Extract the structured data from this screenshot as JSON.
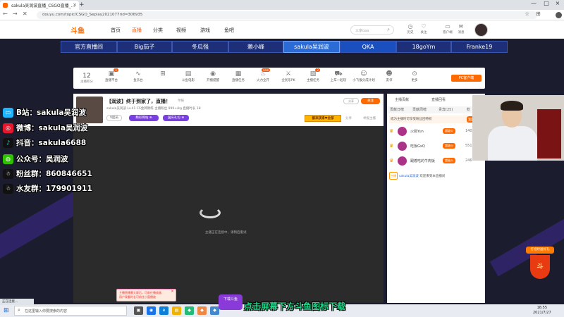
{
  "browser": {
    "tab_title": "sakula吴润波直播_CSGO直播_...",
    "url": "douyu.com/topic/CSGO_Seplay2021077rid=306935"
  },
  "site_nav": {
    "logo": "斗鱼",
    "items": [
      "首页",
      "直播",
      "分类",
      "视频",
      "游戏",
      "鱼吧"
    ],
    "active": "直播",
    "search_placeholder": "三家oaa"
  },
  "header_icons": [
    "历史",
    "关注",
    "客户端",
    "消息"
  ],
  "friend_bar": [
    "官方直播间",
    "Big茄子",
    "冬瓜强",
    "赖小峰",
    "sakula吴润波",
    "QKA",
    "18goYm",
    "Franke19"
  ],
  "friend_bar_active": "sakula吴润波",
  "social": [
    {
      "icon": "bilibili-icon",
      "text": "B站：sakula吴润波",
      "color": "#1fb6ff"
    },
    {
      "icon": "weibo-icon",
      "text": "微博：sakula吴润波",
      "color": "#e6162d"
    },
    {
      "icon": "douyin-icon",
      "text": "抖音：sakula6688",
      "color": "#111"
    },
    {
      "icon": "wechat-icon",
      "text": "公众号：吴润波",
      "color": "#2dc100"
    },
    {
      "icon": "qq-icon",
      "text": "粉丝群：860846651",
      "color": "#111"
    },
    {
      "icon": "qq-icon",
      "text": "水友群：179901911",
      "color": "#111"
    }
  ],
  "toolbar": {
    "level": "12",
    "level_label": "主播积分",
    "items": [
      "直播平台",
      "鱼乐台",
      "",
      "斗鱼电影",
      "开播提醒",
      "直播任务",
      "火力全开",
      "全民乐PK",
      "主播任务",
      "上车一起玩",
      "小飞猴分成计划",
      "友邻",
      "更多"
    ],
    "pc_button": "PC客户端"
  },
  "video": {
    "title": "【润波】终于到家了，直播！",
    "category": "举报",
    "meta": "sakula吴润波  Lv.41  CS金牌教练  主播粉丝  999+/kg  直播时长 18",
    "tag1": "V团员",
    "tag2": "精彩网站 ⊕",
    "tag3": "国庆礼包 ⊕",
    "share": "分享",
    "follow": "关注",
    "record_btn": "都来获得♥全部",
    "share2": "分享",
    "report": "举报主播",
    "loading": "主播正在连接中，请稍后重试",
    "popup_line1": "主播直播需大屏后，可前往播放器",
    "popup_line2": "用户观看时长可前往小窗播放"
  },
  "chat": {
    "tab1": "主播贡献",
    "tab2": "直播回看",
    "tabs": [
      "贡献日榜",
      "贡献周榜",
      "贵宾(25)",
      "粉"
    ],
    "banner": "成为主播时可享受粉丝团特权",
    "banner_btn": "我要赠送",
    "ranks": [
      {
        "name": "火箭Yun",
        "level": "超级火",
        "score": "1405"
      },
      {
        "name": "吃饭GxQ",
        "level": "超级火",
        "score": "551"
      },
      {
        "name": "跟着吃的牛肉饭",
        "level": "超级火",
        "score": "246"
      }
    ],
    "msg_user": "sakula吴润波",
    "msg_text": "欢迎来到本直播间",
    "msg_tag": "主播"
  },
  "gift_widget": {
    "banner": "打招呼送好礼",
    "symbol": "斗"
  },
  "subtitle": "点击屏幕下方斗鱼图标下载",
  "mascot": "下载斗鱼",
  "taskbar": {
    "status": "正在连接...",
    "search": "在这里输入你要搜索的内容",
    "time": "16:55",
    "date": "2021/7/27"
  }
}
